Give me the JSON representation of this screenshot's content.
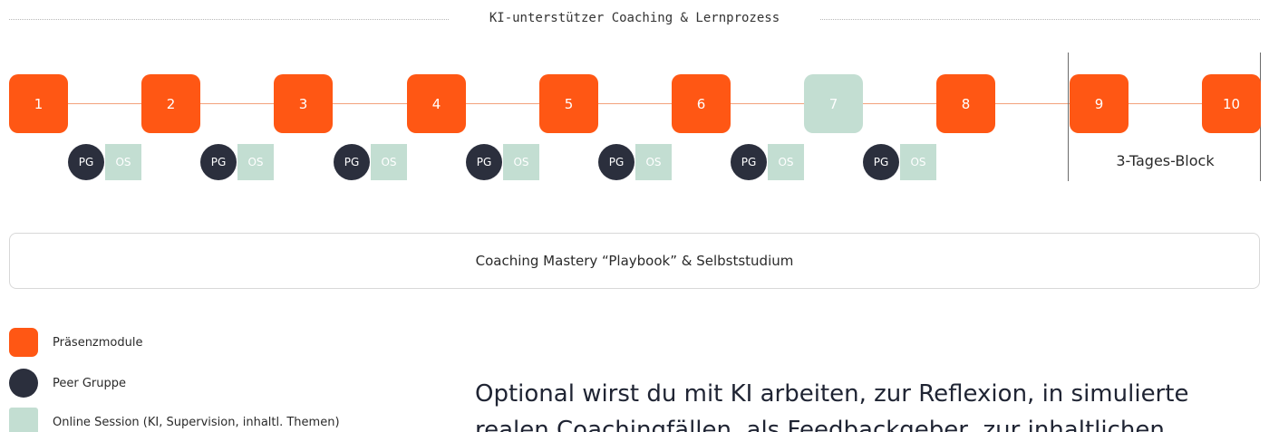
{
  "title": "KI-unterstützer Coaching & Lernprozess",
  "modules": [
    {
      "label": "1",
      "type": "praesenz"
    },
    {
      "label": "2",
      "type": "praesenz"
    },
    {
      "label": "3",
      "type": "praesenz"
    },
    {
      "label": "4",
      "type": "praesenz"
    },
    {
      "label": "5",
      "type": "praesenz"
    },
    {
      "label": "6",
      "type": "praesenz"
    },
    {
      "label": "7",
      "type": "online"
    },
    {
      "label": "8",
      "type": "praesenz"
    },
    {
      "label": "9",
      "type": "praesenz"
    },
    {
      "label": "10",
      "type": "praesenz"
    }
  ],
  "sessions": {
    "pg_label": "PG",
    "os_label": "OS"
  },
  "block_label": "3-Tages-Block",
  "playbook": "Coaching Mastery “Playbook” & Selbststudium",
  "legend": [
    {
      "label": "Präsenzmodule"
    },
    {
      "label": "Peer Gruppe"
    },
    {
      "label": "Online Session (KI, Supervision, inhaltl. Themen)"
    }
  ],
  "optional_text": {
    "line1": "Optional wirst du mit KI arbeiten, zur Reflexion, in simulierte",
    "line2": "realen Coachingfällen, als Feedbackgeber, zur inhaltlichen"
  },
  "colors": {
    "praesenz": "#ff5714",
    "online": "#c3ded2",
    "peer": "#2b2f3d"
  }
}
